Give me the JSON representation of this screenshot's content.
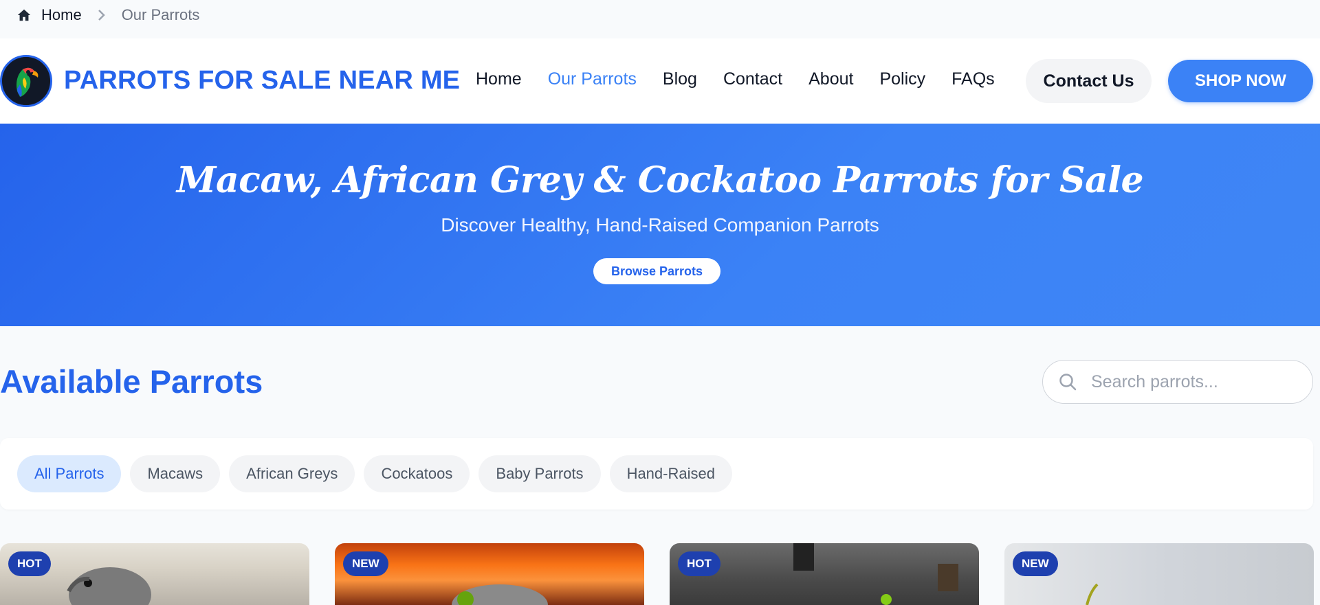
{
  "breadcrumb": {
    "home": "Home",
    "current": "Our Parrots"
  },
  "header": {
    "brand": "PARROTS FOR SALE NEAR ME",
    "nav": [
      "Home",
      "Our Parrots",
      "Blog",
      "Contact",
      "About",
      "Policy",
      "FAQs"
    ],
    "active_nav": "Our Parrots",
    "contact_button": "Contact Us",
    "shop_button": "SHOP NOW"
  },
  "hero": {
    "title": "Macaw, African Grey & Cockatoo Parrots for Sale",
    "subtitle": "Discover Healthy, Hand-Raised Companion Parrots",
    "button": "Browse Parrots"
  },
  "main": {
    "section_title": "Available Parrots",
    "search_placeholder": "Search parrots...",
    "filters": [
      "All Parrots",
      "Macaws",
      "African Greys",
      "Cockatoos",
      "Baby Parrots",
      "Hand-Raised"
    ],
    "active_filter": "All Parrots",
    "cards": [
      {
        "badge": "HOT"
      },
      {
        "badge": "NEW"
      },
      {
        "badge": "HOT"
      },
      {
        "badge": "NEW"
      }
    ]
  },
  "colors": {
    "accent": "#2563eb",
    "accent_light": "#3b82f6",
    "badge": "#1e40af"
  },
  "icons": {
    "breadcrumb_home": "home-icon",
    "breadcrumb_separator": "chevron-right-icon",
    "search": "search-icon"
  }
}
